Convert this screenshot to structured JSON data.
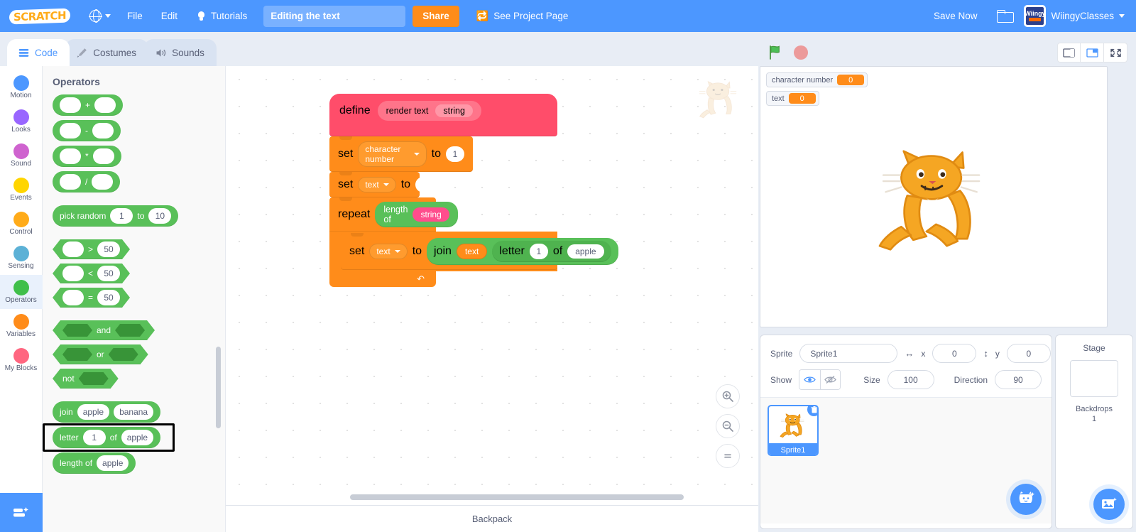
{
  "menubar": {
    "logo_text": "SCRATCH",
    "language_icon": "globe-icon",
    "file_label": "File",
    "edit_label": "Edit",
    "tutorials_label": "Tutorials",
    "project_title": "Editing the text",
    "project_title_placeholder": "Project title",
    "share_label": "Share",
    "project_page_label": "See Project Page",
    "save_now_label": "Save Now",
    "username": "WiingyClasses",
    "avatar_text": "Wiingy"
  },
  "tabs": [
    {
      "label": "Code",
      "icon": "code-icon",
      "active": true
    },
    {
      "label": "Costumes",
      "icon": "paintbrush-icon",
      "active": false
    },
    {
      "label": "Sounds",
      "icon": "speaker-icon",
      "active": false
    }
  ],
  "categories": [
    {
      "label": "Motion",
      "color": "#4c97ff",
      "selected": false
    },
    {
      "label": "Looks",
      "color": "#9966ff",
      "selected": false
    },
    {
      "label": "Sound",
      "color": "#cf63cf",
      "selected": false
    },
    {
      "label": "Events",
      "color": "#ffd500",
      "selected": false
    },
    {
      "label": "Control",
      "color": "#ffab19",
      "selected": false
    },
    {
      "label": "Sensing",
      "color": "#5cb1d6",
      "selected": false
    },
    {
      "label": "Operators",
      "color": "#40bf4a",
      "selected": true
    },
    {
      "label": "Variables",
      "color": "#ff8c1a",
      "selected": false
    },
    {
      "label": "My Blocks",
      "color": "#ff6680",
      "selected": false
    }
  ],
  "palette": {
    "title": "Operators",
    "add_extension_icon": "add-extension-icon",
    "blocks": [
      {
        "id": "add",
        "type": "oval",
        "parts": [
          {
            "k": "slot",
            "v": ""
          },
          {
            "k": "label",
            "v": "+"
          },
          {
            "k": "slot",
            "v": ""
          }
        ]
      },
      {
        "id": "subtract",
        "type": "oval",
        "parts": [
          {
            "k": "slot",
            "v": ""
          },
          {
            "k": "label",
            "v": "-"
          },
          {
            "k": "slot",
            "v": ""
          }
        ]
      },
      {
        "id": "multiply",
        "type": "oval",
        "parts": [
          {
            "k": "slot",
            "v": ""
          },
          {
            "k": "label",
            "v": "*"
          },
          {
            "k": "slot",
            "v": ""
          }
        ]
      },
      {
        "id": "divide",
        "type": "oval",
        "parts": [
          {
            "k": "slot",
            "v": ""
          },
          {
            "k": "label",
            "v": "/"
          },
          {
            "k": "slot",
            "v": ""
          }
        ]
      },
      {
        "id": "gap1",
        "type": "gap",
        "parts": []
      },
      {
        "id": "pick-random",
        "type": "oval",
        "parts": [
          {
            "k": "label",
            "v": "pick random"
          },
          {
            "k": "slot",
            "v": "1"
          },
          {
            "k": "label",
            "v": "to"
          },
          {
            "k": "slot",
            "v": "10"
          }
        ]
      },
      {
        "id": "gap2",
        "type": "gap",
        "parts": []
      },
      {
        "id": "greater",
        "type": "bool",
        "parts": [
          {
            "k": "slot",
            "v": ""
          },
          {
            "k": "label",
            "v": ">"
          },
          {
            "k": "slot",
            "v": "50"
          }
        ]
      },
      {
        "id": "less",
        "type": "bool",
        "parts": [
          {
            "k": "slot",
            "v": ""
          },
          {
            "k": "label",
            "v": "<"
          },
          {
            "k": "slot",
            "v": "50"
          }
        ]
      },
      {
        "id": "equals",
        "type": "bool",
        "parts": [
          {
            "k": "slot",
            "v": ""
          },
          {
            "k": "label",
            "v": "="
          },
          {
            "k": "slot",
            "v": "50"
          }
        ]
      },
      {
        "id": "gap3",
        "type": "gap",
        "parts": []
      },
      {
        "id": "and",
        "type": "bool",
        "parts": [
          {
            "k": "boolslot",
            "v": ""
          },
          {
            "k": "label",
            "v": "and"
          },
          {
            "k": "boolslot",
            "v": ""
          }
        ]
      },
      {
        "id": "or",
        "type": "bool",
        "parts": [
          {
            "k": "boolslot",
            "v": ""
          },
          {
            "k": "label",
            "v": "or"
          },
          {
            "k": "boolslot",
            "v": ""
          }
        ]
      },
      {
        "id": "not",
        "type": "bool",
        "parts": [
          {
            "k": "label",
            "v": "not"
          },
          {
            "k": "boolslot",
            "v": ""
          }
        ]
      },
      {
        "id": "gap4",
        "type": "gap",
        "parts": []
      },
      {
        "id": "join",
        "type": "oval",
        "parts": [
          {
            "k": "label",
            "v": "join"
          },
          {
            "k": "slot",
            "v": "apple"
          },
          {
            "k": "slot",
            "v": "banana"
          }
        ]
      },
      {
        "id": "letter-of",
        "type": "oval",
        "highlighted": true,
        "parts": [
          {
            "k": "label",
            "v": "letter"
          },
          {
            "k": "slot",
            "v": "1"
          },
          {
            "k": "label",
            "v": "of"
          },
          {
            "k": "slot",
            "v": "apple"
          }
        ]
      },
      {
        "id": "length-of",
        "type": "oval",
        "parts": [
          {
            "k": "label",
            "v": "length of"
          },
          {
            "k": "slot",
            "v": "apple"
          }
        ]
      }
    ]
  },
  "script": {
    "define": {
      "keyword": "define",
      "proc_name": "render text",
      "arg": "string"
    },
    "set_char": {
      "keyword": "set",
      "variable": "character number",
      "to": "to",
      "value": "1"
    },
    "set_text": {
      "keyword": "set",
      "variable": "text",
      "to": "to",
      "value": ""
    },
    "repeat": {
      "keyword": "repeat",
      "length_label": "length of",
      "length_arg": "string"
    },
    "set_join": {
      "keyword": "set",
      "variable": "text",
      "to": "to",
      "join_label": "join",
      "join_arg1": "text",
      "letter_label": "letter",
      "letter_index": "1",
      "of_label": "of",
      "letter_string": "apple"
    }
  },
  "code_area": {
    "zoom_in_icon": "zoom-in-icon",
    "zoom_out_icon": "zoom-out-icon",
    "zoom_reset_icon": "zoom-reset-icon"
  },
  "stage": {
    "green_flag_icon": "green-flag-icon",
    "stop_icon": "stop-icon",
    "view_small_icon": "small-stage-icon",
    "view_normal_icon": "normal-stage-icon",
    "view_fullscreen_icon": "fullscreen-icon",
    "monitors": [
      {
        "name": "character number",
        "value": "0"
      },
      {
        "name": "text",
        "value": "0"
      }
    ]
  },
  "sprite_info": {
    "sprite_label": "Sprite",
    "sprite_name": "Sprite1",
    "x_label": "x",
    "x_value": "0",
    "y_label": "y",
    "y_value": "0",
    "show_label": "Show",
    "show_on_icon": "eye-icon",
    "show_off_icon": "eye-slash-icon",
    "size_label": "Size",
    "size_value": "100",
    "direction_label": "Direction",
    "direction_value": "90",
    "sprites": [
      {
        "name": "Sprite1",
        "selected": true,
        "delete_icon": "trash-icon"
      }
    ],
    "add_sprite_icon": "add-sprite-cat-icon"
  },
  "stage_selector": {
    "title": "Stage",
    "backdrops_label": "Backdrops",
    "backdrops_count": "1",
    "add_backdrop_icon": "add-backdrop-icon"
  },
  "backpack": {
    "label": "Backpack"
  },
  "colors": {
    "brand_blue": "#4c97ff",
    "share_orange": "#ff8c1a",
    "operators_green": "#59c059",
    "variables_orange": "#ff8c1a",
    "myblocks_pink": "#ff4d6a"
  }
}
